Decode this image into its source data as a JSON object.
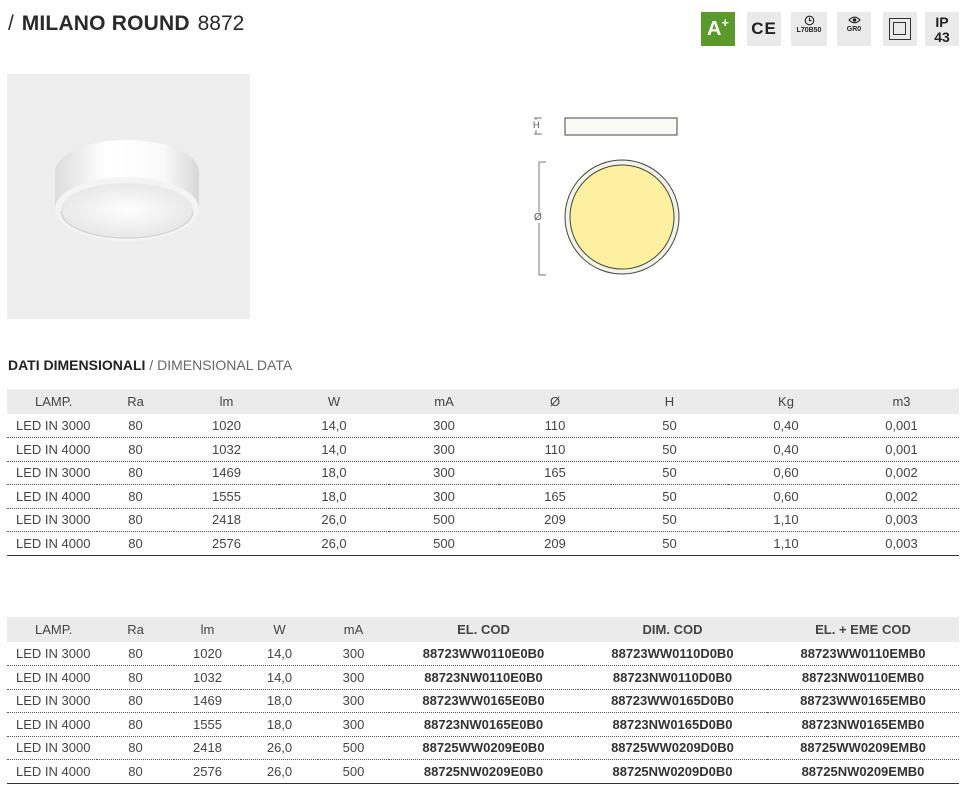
{
  "header": {
    "slash": "/",
    "product_name": "MILANO ROUND",
    "product_code": "8872"
  },
  "badges": {
    "energy_class": "A",
    "energy_class_sup": "+",
    "ce": "CE",
    "lifetime": "L70B50",
    "photobiological": "GR0",
    "ip_top": "IP",
    "ip_bottom": "43",
    "icons": [
      "energy-class-icon",
      "ce-mark-icon",
      "clock-icon",
      "eye-icon",
      "class-ii-icon",
      "ip-rating-icon"
    ],
    "colors": {
      "energy_green": "#5a9a2a",
      "badge_bg": "#eaeaea"
    }
  },
  "drawing": {
    "height_label": "H",
    "diameter_label": "Ø",
    "colors": {
      "lens": "#fdf0a0",
      "ring": "#f3f3e6"
    }
  },
  "section": {
    "title_it": "DATI DIMENSIONALI",
    "separator": "/",
    "title_en": "DIMENSIONAL DATA"
  },
  "dimensional_table": {
    "headers": [
      "LAMP.",
      "Ra",
      "lm",
      "W",
      "mA",
      "Ø",
      "H",
      "Kg",
      "m3"
    ],
    "rows": [
      [
        "LED IN 3000",
        "80",
        "1020",
        "14,0",
        "300",
        "110",
        "50",
        "0,40",
        "0,001"
      ],
      [
        "LED IN 4000",
        "80",
        "1032",
        "14,0",
        "300",
        "110",
        "50",
        "0,40",
        "0,001"
      ],
      [
        "LED IN 3000",
        "80",
        "1469",
        "18,0",
        "300",
        "165",
        "50",
        "0,60",
        "0,002"
      ],
      [
        "LED IN 4000",
        "80",
        "1555",
        "18,0",
        "300",
        "165",
        "50",
        "0,60",
        "0,002"
      ],
      [
        "LED IN 3000",
        "80",
        "2418",
        "26,0",
        "500",
        "209",
        "50",
        "1,10",
        "0,003"
      ],
      [
        "LED IN 4000",
        "80",
        "2576",
        "26,0",
        "500",
        "209",
        "50",
        "1,10",
        "0,003"
      ]
    ]
  },
  "code_table": {
    "headers": [
      "LAMP.",
      "Ra",
      "lm",
      "W",
      "mA",
      "EL. COD",
      "DIM. COD",
      "EL. + EME COD"
    ],
    "rows": [
      [
        "LED IN 3000",
        "80",
        "1020",
        "14,0",
        "300",
        "88723WW0110E0B0",
        "88723WW0110D0B0",
        "88723WW0110EMB0"
      ],
      [
        "LED IN 4000",
        "80",
        "1032",
        "14,0",
        "300",
        "88723NW0110E0B0",
        "88723NW0110D0B0",
        "88723NW0110EMB0"
      ],
      [
        "LED IN 3000",
        "80",
        "1469",
        "18,0",
        "300",
        "88723WW0165E0B0",
        "88723WW0165D0B0",
        "88723WW0165EMB0"
      ],
      [
        "LED IN 4000",
        "80",
        "1555",
        "18,0",
        "300",
        "88723NW0165E0B0",
        "88723NW0165D0B0",
        "88723NW0165EMB0"
      ],
      [
        "LED IN 3000",
        "80",
        "2418",
        "26,0",
        "500",
        "88725WW0209E0B0",
        "88725WW0209D0B0",
        "88725WW0209EMB0"
      ],
      [
        "LED IN 4000",
        "80",
        "2576",
        "26,0",
        "500",
        "88725NW0209E0B0",
        "88725NW0209D0B0",
        "88725NW0209EMB0"
      ]
    ]
  }
}
